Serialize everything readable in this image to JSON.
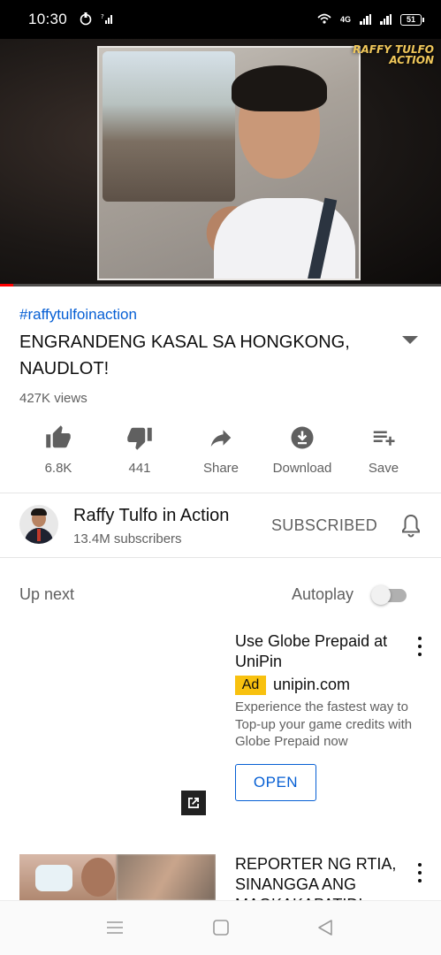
{
  "status_bar": {
    "time": "10:30",
    "network_label": "4G",
    "battery_level": "51"
  },
  "video": {
    "watermark_line1": "RAFFY TULFO",
    "watermark_line2": "ACTION",
    "progress_fraction": 0.03
  },
  "info": {
    "hashtag": "#raffytulfoinaction",
    "title": "ENGRANDENG KASAL SA HONGKONG, NAUDLOT!",
    "views": "427K views"
  },
  "actions": [
    {
      "name": "like",
      "label": "6.8K",
      "icon": "thumb-up-icon"
    },
    {
      "name": "dislike",
      "label": "441",
      "icon": "thumb-down-icon"
    },
    {
      "name": "share",
      "label": "Share",
      "icon": "share-icon"
    },
    {
      "name": "download",
      "label": "Download",
      "icon": "download-icon"
    },
    {
      "name": "save",
      "label": "Save",
      "icon": "playlist-add-icon"
    }
  ],
  "channel": {
    "name": "Raffy Tulfo in Action",
    "subscribers": "13.4M subscribers",
    "subscribe_state": "SUBSCRIBED"
  },
  "up_next": {
    "label": "Up next",
    "autoplay_label": "Autoplay",
    "autoplay_on": false
  },
  "ad": {
    "title": "Use Globe Prepaid at UniPin",
    "badge": "Ad",
    "domain": "unipin.com",
    "description": "Experience the fastest way to Top-up your game credits with Globe Prepaid now",
    "cta": "OPEN"
  },
  "next_video": {
    "title": "REPORTER NG RTIA, SINANGGA ANG MAGKAKAPATID!"
  },
  "colors": {
    "link": "#065fd4",
    "secondary_text": "#606060",
    "ad_badge": "#f8c10f",
    "progress": "#ff0000"
  }
}
